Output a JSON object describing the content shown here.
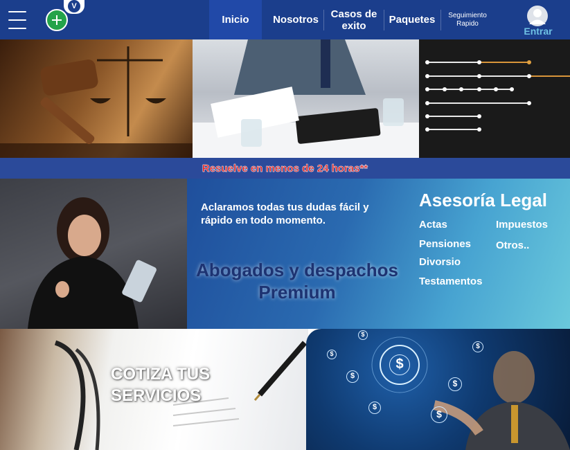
{
  "nav": {
    "badge": "V",
    "items": [
      {
        "label": "Inicio",
        "active": true
      },
      {
        "label": "Nosotros"
      },
      {
        "label": "Casos de exito"
      },
      {
        "label": "Paquetes"
      },
      {
        "label": "Seguimiento Rapido"
      }
    ],
    "login_label": "Entrar"
  },
  "banner": {
    "text": "Resuelve  en menos de 24 horas**"
  },
  "promo": {
    "subtitle": "Aclaramos todas tus dudas fácil y rápido en todo momento.",
    "title": "Abogados y despachos Premium",
    "legal_title": "Asesoría Legal",
    "services_left": [
      "Actas",
      "Pensiones",
      "Divorsio",
      "Testamentos"
    ],
    "services_right": [
      "Impuestos",
      "Otros.."
    ]
  },
  "cta": {
    "text": "COTIZA TUS SERVICIOS"
  },
  "colors": {
    "nav_bg": "#1b3e8c",
    "banner_text": "#e11d1d",
    "login": "#6ec1e4",
    "promo_title": "#1d3372"
  },
  "icons": [
    "menu-icon",
    "plus-icon",
    "user-avatar-icon",
    "dollar-icon"
  ]
}
